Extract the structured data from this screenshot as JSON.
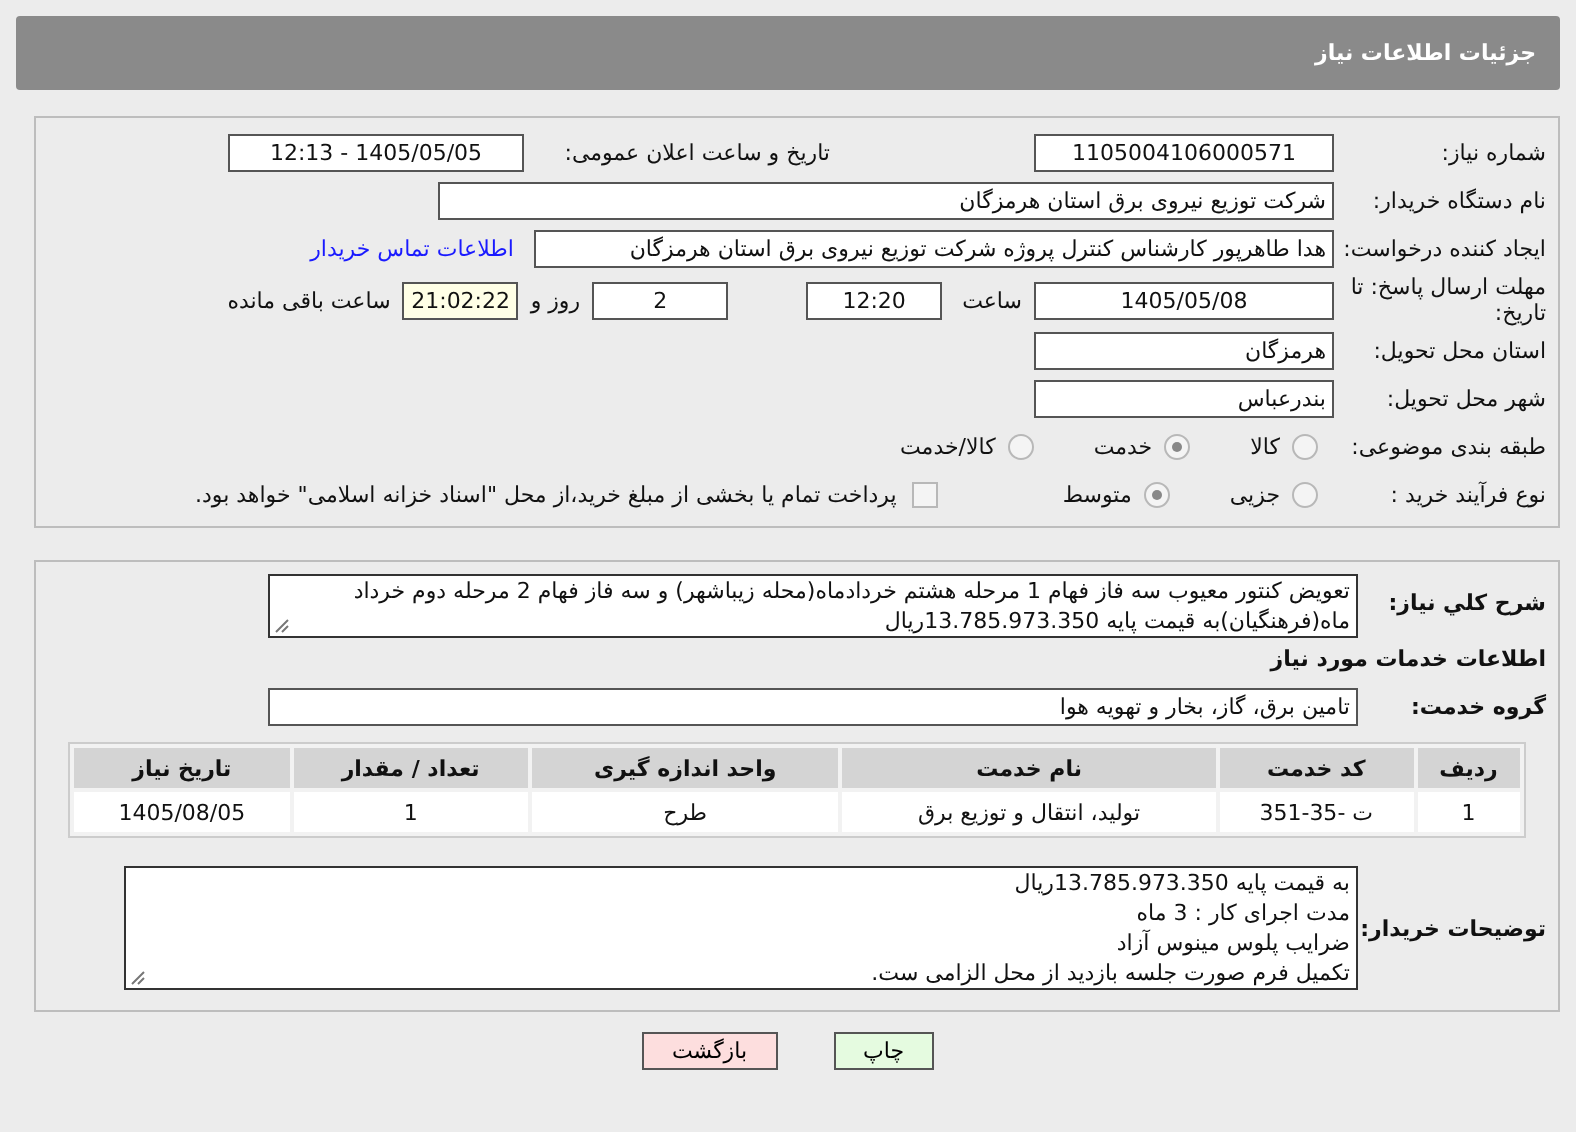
{
  "header": {
    "title": "جزئیات اطلاعات نیاز"
  },
  "need_number": {
    "label": "شماره نیاز:",
    "value": "1105004106000571"
  },
  "announce": {
    "label": "تاریخ و ساعت اعلان عمومی:",
    "value": "1405/05/05 - 12:13"
  },
  "buyer": {
    "label": "نام دستگاه خریدار:",
    "value": "شرکت توزیع نیروی برق استان هرمزگان"
  },
  "requester": {
    "label": "ایجاد کننده درخواست:",
    "value": "هدا طاهرپور کارشناس کنترل پروژه شرکت توزیع نیروی برق استان هرمزگان",
    "link": "اطلاعات تماس خریدار"
  },
  "deadline": {
    "label": "مهلت ارسال پاسخ: تا تاریخ:",
    "date": "1405/05/08",
    "time_label": "ساعت",
    "time": "12:20",
    "days": "2",
    "days_label": "روز و",
    "remaining": "21:02:22",
    "remaining_label": "ساعت باقی مانده"
  },
  "province": {
    "label": "استان محل تحویل:",
    "value": "هرمزگان"
  },
  "city": {
    "label": "شهر محل تحویل:",
    "value": "بندرعباس"
  },
  "category": {
    "label": "طبقه بندی موضوعی:",
    "options": [
      {
        "label": "کالا",
        "selected": false
      },
      {
        "label": "خدمت",
        "selected": true
      },
      {
        "label": "کالا/خدمت",
        "selected": false
      }
    ]
  },
  "process": {
    "label": "نوع فرآیند خرید :",
    "options": [
      {
        "label": "جزیی",
        "selected": false
      },
      {
        "label": "متوسط",
        "selected": true
      }
    ],
    "payment": {
      "checked": false,
      "label": "پرداخت تمام یا بخشی از مبلغ خرید،از محل \"اسناد خزانه اسلامی\" خواهد بود."
    }
  },
  "summary": {
    "label": "شرح کلي نياز:",
    "value": "تعویض کنتور معیوب سه فاز فهام 1 مرحله هشتم خردادماه(محله زیباشهر) و  سه فاز فهام 2 مرحله دوم خرداد ماه(فرهنگیان)به قیمت  پایه  13.785.973.350ریال"
  },
  "services_title": "اطلاعات خدمات مورد نیاز",
  "service_group": {
    "label": "گروه خدمت:",
    "value": "تامین برق، گاز، بخار و تهویه هوا"
  },
  "table": {
    "columns": [
      "ردیف",
      "کد خدمت",
      "نام خدمت",
      "واحد اندازه گیری",
      "تعداد / مقدار",
      "تاریخ نیاز"
    ],
    "rows": [
      [
        "1",
        "ت -35-351",
        "تولید، انتقال و توزیع برق",
        "طرح",
        "1",
        "1405/08/05"
      ]
    ]
  },
  "notes": {
    "label": "توضیحات خریدار:",
    "lines": [
      "به قیمت  پایه   13.785.973.350ریال",
      "مدت اجرای کار : 3 ماه",
      "ضرایب پلوس مینوس آزاد",
      "تکمیل فرم صورت جلسه بازدید از محل الزامی ست."
    ]
  },
  "buttons": [
    {
      "label": "چاپ",
      "kind": "print"
    },
    {
      "label": "بازگشت",
      "kind": "back"
    }
  ]
}
